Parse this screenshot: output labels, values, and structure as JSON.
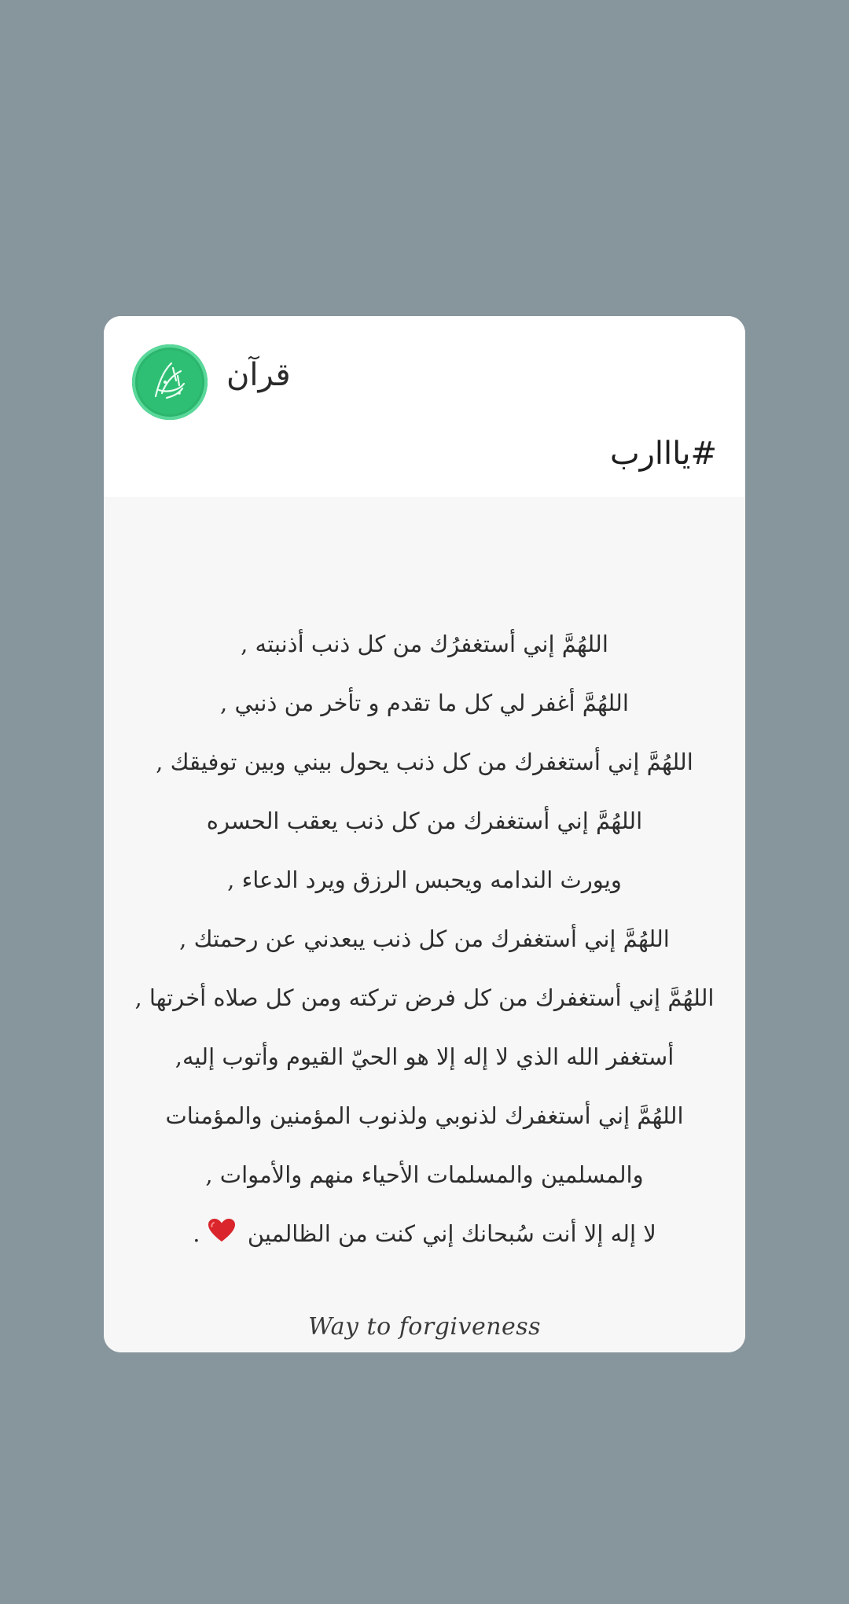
{
  "channel": {
    "name": "قرآن",
    "avatar_color": "#2fbf74",
    "avatar_icon": "arabic-calligraphy-logo"
  },
  "post": {
    "hashtag": "#يااارب",
    "image": {
      "background": "#f7f7f7",
      "lines": [
        "اللهُمَّ إني أستغفرُك من كل ذنب أذنبته ,",
        "اللهُمَّ أغفر لي كل ما تقدم و تأخر من ذنبي ,",
        "اللهُمَّ إني أستغفرك من كل ذنب يحول بيني وبين توفيقك ,",
        "اللهُمَّ إني أستغفرك من كل ذنب يعقب الحسره",
        "ويورث الندامه ويحبس الرزق ويرد الدعاء ,",
        "اللهُمَّ إني أستغفرك من كل ذنب يبعدني عن رحمتك ,",
        "اللهُمَّ إني أستغفرك من كل فرض تركته ومن كل صلاه أخرتها ,",
        "أستغفر الله الذي لا إله إلا هو الحيّ القيوم وأتوب إليه,",
        "اللهُمَّ إني أستغفرك لذنوبي ولذنوب المؤمنين والمؤمنات",
        "والمسلمين والمسلمات الأحياء منهم والأموات ,"
      ],
      "last_line": "لا إله إلا أنت سُبحانك إني كنت من الظالمين",
      "last_line_end": ".",
      "heart_icon": "red-heart-emoji",
      "heart_color": "#d9252b",
      "footer": "Way to forgiveness"
    }
  },
  "colors": {
    "page_background": "#87959c",
    "card_background": "#ffffff"
  }
}
